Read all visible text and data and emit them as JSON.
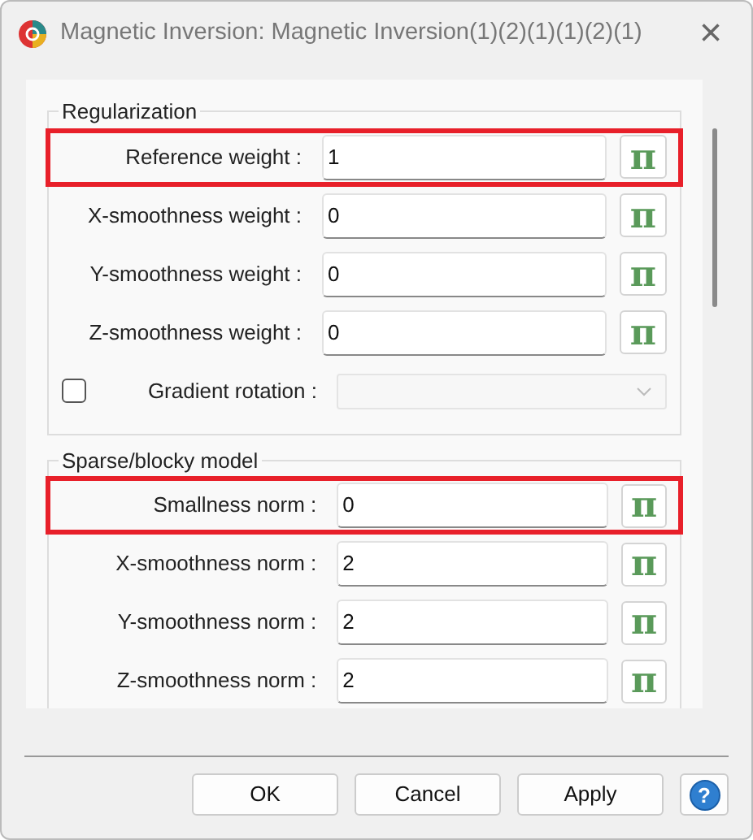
{
  "window": {
    "title": "Magnetic Inversion: Magnetic Inversion(1)(2)(1)(1)(2)(1)",
    "close": "×"
  },
  "groups": [
    {
      "title": "Regularization",
      "rows": [
        {
          "kind": "field",
          "label": "Reference weight :",
          "value": "1",
          "button": "π",
          "highlighted": true
        },
        {
          "kind": "field",
          "label": "X-smoothness weight :",
          "value": "0",
          "button": "π",
          "highlighted": false
        },
        {
          "kind": "field",
          "label": "Y-smoothness weight :",
          "value": "0",
          "button": "π",
          "highlighted": false
        },
        {
          "kind": "field",
          "label": "Z-smoothness weight :",
          "value": "0",
          "button": "π",
          "highlighted": false
        },
        {
          "kind": "checkcombo",
          "label": "Gradient rotation :",
          "checked": false,
          "disabled": true,
          "highlighted": false
        }
      ]
    },
    {
      "title": "Sparse/blocky model",
      "rows": [
        {
          "kind": "field",
          "label": "Smallness norm :",
          "value": "0",
          "button": "π",
          "highlighted": true
        },
        {
          "kind": "field",
          "label": "X-smoothness norm :",
          "value": "2",
          "button": "π",
          "highlighted": false
        },
        {
          "kind": "field",
          "label": "Y-smoothness norm :",
          "value": "2",
          "button": "π",
          "highlighted": false
        },
        {
          "kind": "field",
          "label": "Z-smoothness norm :",
          "value": "2",
          "button": "π",
          "highlighted": false
        }
      ]
    }
  ],
  "buttons": [
    "OK",
    "Cancel",
    "Apply"
  ],
  "help": "?"
}
